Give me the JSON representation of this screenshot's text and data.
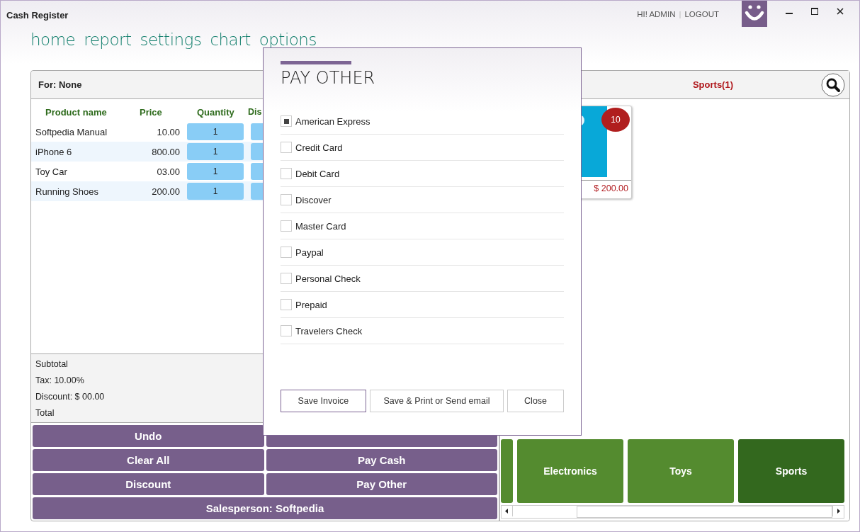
{
  "window": {
    "title": "Cash Register"
  },
  "user": {
    "greeting": "HI! ADMIN",
    "separator": "|",
    "logout": "LOGOUT"
  },
  "nav": [
    {
      "label": "home"
    },
    {
      "label": "report"
    },
    {
      "label": "settings"
    },
    {
      "label": "chart"
    },
    {
      "label": "options"
    }
  ],
  "order": {
    "customer": "For: None",
    "columns": [
      "Product name",
      "Price",
      "Quantity",
      "Dis"
    ],
    "rows": [
      {
        "name": "Softpedia Manual",
        "price": "10.00",
        "quantity": "1"
      },
      {
        "name": "iPhone 6",
        "price": "800.00",
        "quantity": "1"
      },
      {
        "name": "Toy Car",
        "price": "03.00",
        "quantity": "1"
      },
      {
        "name": "Running Shoes",
        "price": "200.00",
        "quantity": "1"
      }
    ],
    "summary": [
      "Subtotal",
      "Tax: 10.00%",
      "Discount: $ 00.00",
      "Total"
    ],
    "buttons": [
      {
        "label": "Undo",
        "wide": false
      },
      {
        "wide": false
      },
      {
        "label": "Clear All",
        "wide": false
      },
      {
        "label": "Pay Cash",
        "wide": false
      },
      {
        "label": "Discount",
        "wide": false
      },
      {
        "label": "Pay Other",
        "wide": false
      },
      {
        "label": "Salesperson: Softpedia",
        "wide": true
      }
    ]
  },
  "catalog": {
    "category_title": "Sports(1)",
    "products": [
      {
        "badge": "10",
        "price": "$ 200.00"
      }
    ],
    "categories": [
      {
        "selected": false
      },
      {
        "label": "Electronics",
        "selected": false
      },
      {
        "label": "Toys",
        "selected": false
      },
      {
        "label": "Sports",
        "selected": true
      }
    ]
  },
  "dialog": {
    "title": "PAY OTHER",
    "options": [
      {
        "label": "American Express",
        "checked": true
      },
      {
        "label": "Credit Card",
        "checked": false
      },
      {
        "label": "Debit Card",
        "checked": false
      },
      {
        "label": "Discover",
        "checked": false
      },
      {
        "label": "Master Card",
        "checked": false
      },
      {
        "label": "Paypal",
        "checked": false
      },
      {
        "label": "Personal Check",
        "checked": false
      },
      {
        "label": "Prepaid",
        "checked": false
      },
      {
        "label": "Travelers Check",
        "checked": false
      }
    ],
    "buttons": [
      {
        "label": "Save Invoice",
        "primary": true
      },
      {
        "label": "Save & Print or Send email",
        "primary": false
      },
      {
        "label": "Close",
        "primary": false
      }
    ]
  }
}
